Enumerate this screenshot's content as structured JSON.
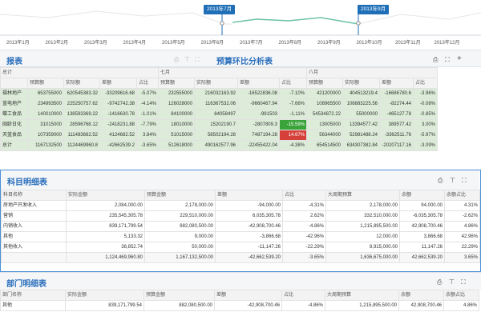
{
  "timeline": {
    "months": [
      "2013年1月",
      "2013年2月",
      "2013年3月",
      "2013年4月",
      "2013年5月",
      "2013年6月",
      "2013年7月",
      "2013年8月",
      "2013年9月",
      "2013年10月",
      "2013年11月",
      "2013年12月"
    ],
    "start_marker": "2013年7月",
    "end_marker": "2013年9月"
  },
  "report_panel": {
    "title": "报表",
    "sub_title": "预算环比分析表"
  },
  "budget_table": {
    "period_headers": [
      "总计",
      "七月",
      "八月"
    ],
    "column_headers": [
      "预算额",
      "实际额",
      "差额",
      "占比",
      "预算额",
      "实际额",
      "差额",
      "占比",
      "预算额",
      "实际额",
      "差额",
      "占比"
    ],
    "rows": [
      {
        "name": "福林地产",
        "cells": [
          "653755000",
          "620545383.32",
          "-33209616.68",
          "-5.07%",
          "232555000",
          "216032163.92",
          "-16522836.08",
          "-7.10%",
          "421200000",
          "404513219.4",
          "-16686780.6",
          "-3.96%"
        ]
      },
      {
        "name": "蓝电地产",
        "cells": [
          "234993500",
          "225250757.62",
          "-9742742.38",
          "-4.14%",
          "126028000",
          "116367532.06",
          "-9660467.94",
          "-7.66%",
          "108965500",
          "108883225.56",
          "-82274.44",
          "-0.08%"
        ]
      },
      {
        "name": "蝶工食品",
        "cells": [
          "140010000",
          "138593369.22",
          "-1416630.78",
          "-1.01%",
          "84100000",
          "84058497",
          "-991503",
          "-1.11%",
          "54534872.22",
          "55000000",
          "-465127.78",
          "-0.85%"
        ]
      },
      {
        "name": "闽龄日化",
        "cells": [
          "31015000",
          "28596768.12",
          "-2418231.88",
          "-7.79%",
          "18010000",
          "15202190.7",
          "-2807809.3",
          "-15.59%",
          "13005000",
          "13394577.42",
          "389577.42",
          "3.00%"
        ]
      },
      {
        "name": "天蓝食品",
        "cells": [
          "107359000",
          "111483682.52",
          "4124682.52",
          "3.84%",
          "51015000",
          "58502194.28",
          "7487194.28",
          "14.67%",
          "56344000",
          "52981488.24",
          "-3362511.76",
          "-5.97%"
        ]
      },
      {
        "name": "总计",
        "cells": [
          "1167132500",
          "1124469960.8",
          "-42662539.2",
          "-3.65%",
          "512618000",
          "490162577.96",
          "-22455422.04",
          "-4.38%",
          "654514500",
          "634307382.84",
          "-20207117.16",
          "-3.09%"
        ]
      }
    ]
  },
  "subject_panel": {
    "title": "科目明细表",
    "column_headers": [
      "科目名称",
      "实际金额",
      "预算金额",
      "差额",
      "占比",
      "大周期预算",
      "余额",
      "余额占比"
    ],
    "rows": [
      {
        "cells": [
          "房地产开发收入",
          "2,084,000.00",
          "2,178,000.00",
          "-94,000.00",
          "-4.31%",
          "2,178,000.00",
          "94,000.00",
          "4.31%"
        ]
      },
      {
        "cells": [
          "营销",
          "235,545,305.78",
          "229,510,000.00",
          "6,035,305.78",
          "2.62%",
          "332,510,000.00",
          "-6,035,305.78",
          "-2.62%"
        ]
      },
      {
        "cells": [
          "内销收入",
          "839,171,799.54",
          "882,080,500.00",
          "-42,908,700.46",
          "-4.86%",
          "1,215,895,500.00",
          "42,908,700.46",
          "4.86%"
        ]
      },
      {
        "cells": [
          "其他",
          "5,133.32",
          "9,000.00",
          "-3,866.68",
          "-42.96%",
          "12,000.00",
          "3,866.68",
          "42.96%"
        ]
      },
      {
        "cells": [
          "其他收入",
          "38,852.74",
          "50,000.00",
          "-11,147.26",
          "-22.29%",
          "8,915,000.00",
          "11,147.26",
          "22.29%"
        ]
      }
    ],
    "totals": [
      "",
      "1,124,469,960.80",
      "1,167,132,500.00",
      "-42,662,539.20",
      "-3.65%",
      "1,636,675,000.00",
      "42,662,539.20",
      "3.65%"
    ]
  },
  "dept_panel": {
    "title": "部门明细表",
    "column_headers": [
      "部门名称",
      "实际金额",
      "预算金额",
      "差额",
      "占比",
      "大周期预算",
      "余额",
      "余额占比"
    ],
    "rows": [
      {
        "cells": [
          "其他",
          "839,171,799.54",
          "882,080,500.00",
          "-42,908,700.46",
          "-4.86%",
          "1,215,895,500.00",
          "42,908,700.46",
          "4.86%"
        ]
      }
    ]
  },
  "colors": {
    "accent": "#2a6ebb",
    "marker": "#1f6fb7",
    "positive": "#3aa33a",
    "negative": "#d6403a",
    "row_fill": "#dcecd8"
  },
  "icons": [
    "export-icon",
    "filter-icon",
    "expand-icon",
    "add-icon"
  ]
}
